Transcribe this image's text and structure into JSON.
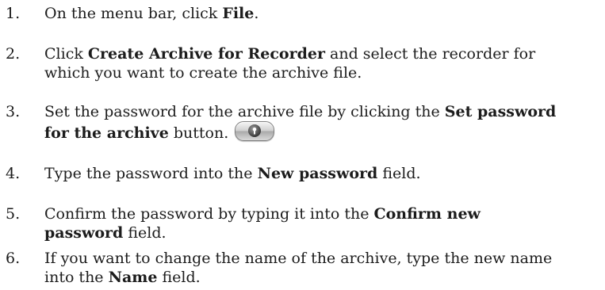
{
  "steps": [
    {
      "number": "1.",
      "parts": [
        "On the menu bar, click ",
        "File",
        "."
      ]
    },
    {
      "number": "2.",
      "parts": [
        "Click ",
        "Create Archive for Recorder",
        " and select the recorder for",
        "which you want to create the archive file."
      ]
    },
    {
      "number": "3.",
      "parts": [
        "Set the password for the archive file by clicking the ",
        "Set password",
        "for the archive",
        " button."
      ],
      "icon": "set-password-button-icon"
    },
    {
      "number": "4.",
      "parts": [
        "Type the password into the ",
        "New password",
        " field."
      ]
    },
    {
      "number": "5.",
      "parts": [
        "Confirm the password by typing it into the ",
        "Confirm new",
        "password",
        " field."
      ]
    },
    {
      "number": "6.",
      "parts": [
        "If you want to change the name of the archive, type the new name",
        "into the ",
        "Name",
        " field."
      ]
    }
  ]
}
